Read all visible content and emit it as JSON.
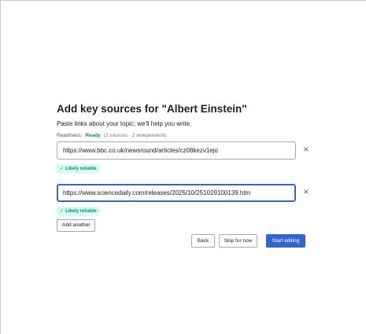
{
  "page": {
    "title": "Add key sources for \"Albert Einstein\"",
    "subtitle": "Paste links about your topic; we'll help you write.",
    "readiness": {
      "label": "Readiness:",
      "status": "Ready",
      "detail": "(2 sources · 2 independent)"
    }
  },
  "sources": [
    {
      "url": "https://www.bbc.co.uk/newsround/articles/cz08kezv1ejo",
      "badge": "Likely reliable",
      "remove_symbol": "×"
    },
    {
      "url": "https://www.sciencedaily.com/releases/2025/10/251029100139.htm",
      "badge": "Likely reliable",
      "remove_symbol": "×"
    }
  ],
  "badge_check_symbol": "✓",
  "add_another_label": "Add another",
  "actions": {
    "back_label": "Back",
    "skip_label": "Skip for now",
    "start_label": "Start editing"
  },
  "colors": {
    "accent": "#3366cc",
    "success": "#14866d",
    "badge_bg": "#d5fdf4"
  }
}
